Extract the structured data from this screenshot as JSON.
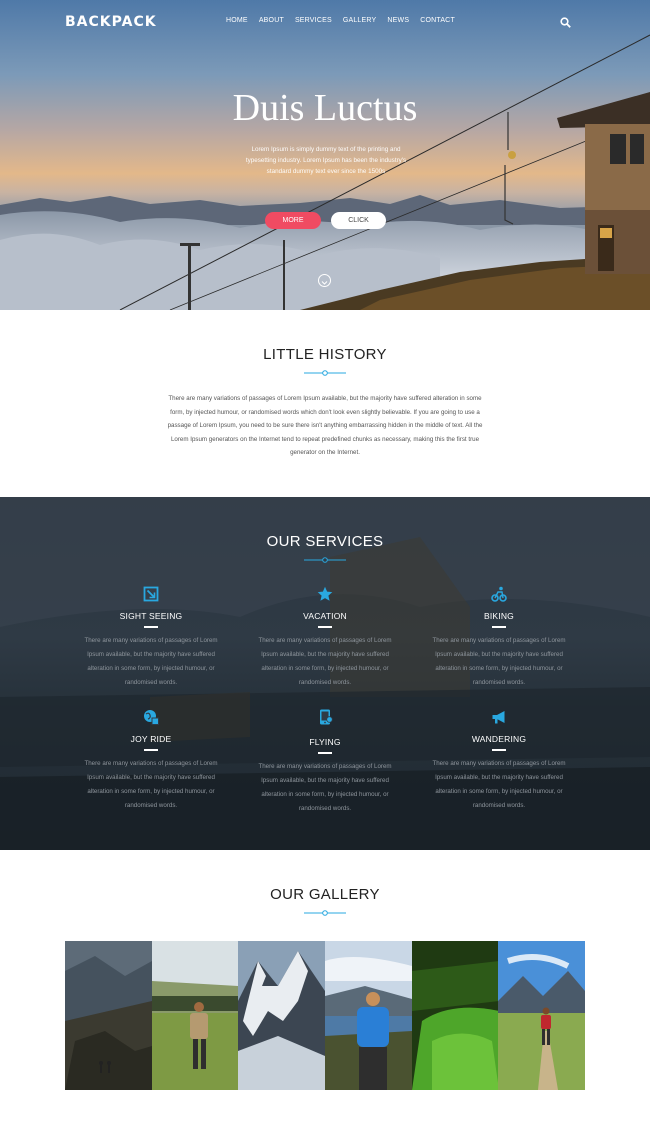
{
  "nav": {
    "logo": "BACKPACK",
    "items": [
      "HOME",
      "ABOUT",
      "SERVICES",
      "GALLERY",
      "NEWS",
      "CONTACT"
    ]
  },
  "hero": {
    "title": "Duis Luctus",
    "text": "Lorem Ipsum is simply dummy text of the printing and typesetting industry. Lorem Ipsum has been the industry's standard dummy text ever since the 1500s",
    "more_label": "MORE",
    "click_label": "CLICK"
  },
  "history": {
    "title": "LITTLE HISTORY",
    "text": "There are many variations of passages of Lorem Ipsum available, but the majority have suffered alteration in some form, by injected humour, or randomised words which don't look even slightly believable. If you are going to use a passage of Lorem Ipsum, you need to be sure there isn't anything embarrassing hidden in the middle of text. All the Lorem Ipsum generators on the Internet tend to repeat predefined chunks as necessary, making this the first true generator on the Internet."
  },
  "services": {
    "title": "OUR SERVICES",
    "items": [
      {
        "name": "SIGHT SEEING",
        "icon": "sight-seeing-icon",
        "desc": "There are many variations of passages of Lorem Ipsum available, but the majority have suffered alteration in some form, by injected humour, or randomised words."
      },
      {
        "name": "VACATION",
        "icon": "star-icon",
        "desc": "There are many variations of passages of Lorem Ipsum available, but the majority have suffered alteration in some form, by injected humour, or randomised words."
      },
      {
        "name": "BIKING",
        "icon": "biking-icon",
        "desc": "There are many variations of passages of Lorem Ipsum available, but the majority have suffered alteration in some form, by injected humour, or randomised words."
      },
      {
        "name": "JOY RIDE",
        "icon": "globe-icon",
        "desc": "There are many variations of passages of Lorem Ipsum available, but the majority have suffered alteration in some form, by injected humour, or randomised words."
      },
      {
        "name": "FLYING",
        "icon": "mobile-icon",
        "desc": "There are many variations of passages of Lorem Ipsum available, but the majority have suffered alteration in some form, by injected humour, or randomised words."
      },
      {
        "name": "WANDERING",
        "icon": "megaphone-icon",
        "desc": "There are many variations of passages of Lorem Ipsum available, but the majority have suffered alteration in some form, by injected humour, or randomised words."
      }
    ]
  },
  "gallery": {
    "title": "OUR GALLERY"
  },
  "colors": {
    "accent": "#29a8e0",
    "more_button": "#f04b62"
  }
}
